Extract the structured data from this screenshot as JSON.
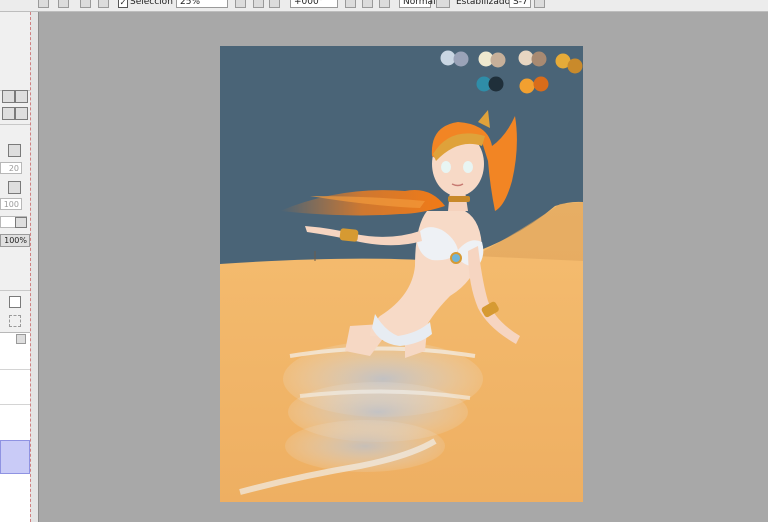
{
  "toolbar": {
    "selection_label": "Selección",
    "zoom_value": "25%",
    "rotation_value": "+000°",
    "blend_mode": "Normal",
    "stabilizer_label": "Estabilizador",
    "stabilizer_value": "S-7"
  },
  "left_panel": {
    "field_1": "20",
    "field_2": "100",
    "opacity_value": "100%"
  },
  "palette_colors": [
    "#c9d6e3",
    "#9aa3b8",
    "#efe9cf",
    "#c7b09a",
    "#e7d6c2",
    "#a88a72",
    "#e6ab39",
    "#c98a2b",
    "#2f8da8",
    "#1f2f3a",
    "#f2a030",
    "#d96c1a"
  ],
  "canvas": {
    "background_color": "#4a6477",
    "sand_color": "#f3b96a",
    "hair_color": "#f07d1e"
  }
}
